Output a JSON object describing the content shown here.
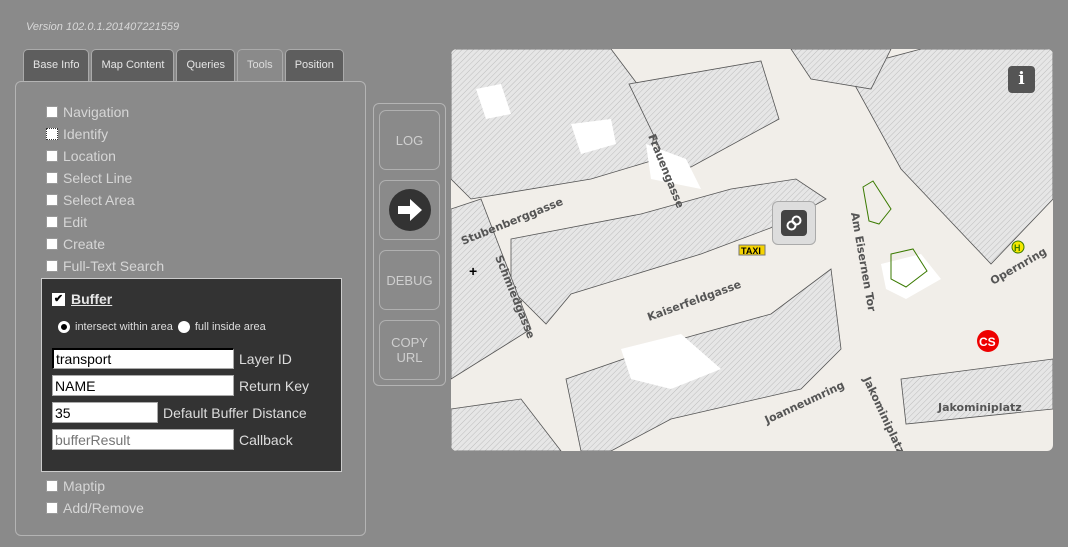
{
  "version": "Version 102.0.1.201407221559",
  "tabs": [
    {
      "label": "Base Info"
    },
    {
      "label": "Map Content"
    },
    {
      "label": "Queries"
    },
    {
      "label": "Tools",
      "active": true
    },
    {
      "label": "Position"
    }
  ],
  "tools": [
    {
      "label": "Navigation",
      "checked": false
    },
    {
      "label": "Identify",
      "checked": false
    },
    {
      "label": "Location",
      "checked": false
    },
    {
      "label": "Select Line",
      "checked": false
    },
    {
      "label": "Select Area",
      "checked": false
    },
    {
      "label": "Edit",
      "checked": false
    },
    {
      "label": "Create",
      "checked": false
    },
    {
      "label": "Full-Text Search",
      "checked": false
    }
  ],
  "buffer": {
    "label": "Buffer",
    "checked": true,
    "radio_intersect": "intersect within area",
    "radio_full": "full inside area",
    "layer_id": {
      "value": "transport",
      "label": "Layer ID"
    },
    "return_key": {
      "value": "NAME",
      "label": "Return Key"
    },
    "distance": {
      "value": "35",
      "label": "Default Buffer Distance"
    },
    "callback": {
      "placeholder": "bufferResult",
      "label": "Callback"
    }
  },
  "tools_after": [
    {
      "label": "Maptip",
      "checked": false
    },
    {
      "label": "Add/Remove",
      "checked": false
    }
  ],
  "side_buttons": {
    "log": "LOG",
    "debug": "DEBUG",
    "copy_url_1": "COPY",
    "copy_url_2": "URL"
  },
  "map": {
    "streets": [
      "Stubenberggasse",
      "Frauengasse",
      "Schmiedgasse",
      "Kaiserfeldgasse",
      "Am Eisernen Tor",
      "Opernring",
      "Joanneumring",
      "Jakominiplatz"
    ],
    "taxi": "TAXI",
    "carsharing": "CS",
    "bus": "H",
    "info": "i"
  }
}
